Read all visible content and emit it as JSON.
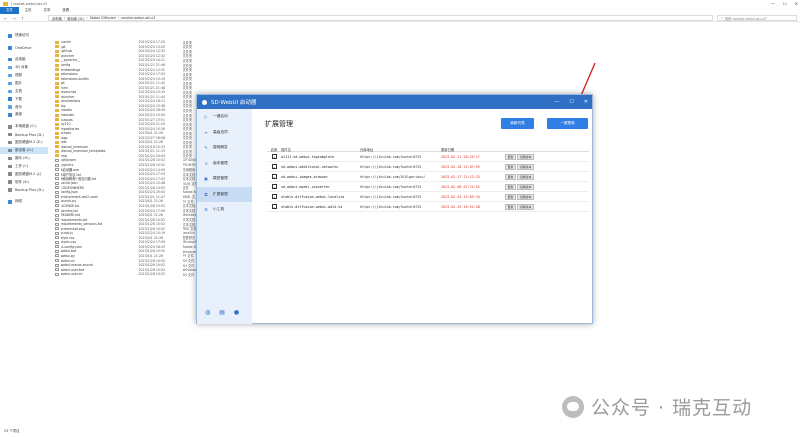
{
  "explorer": {
    "title_path": "| revelat-webui-akl-v3",
    "window_controls": [
      "—",
      "☐",
      "✕"
    ],
    "tabs": [
      "文件",
      "主页",
      "共享",
      "查看"
    ],
    "address": [
      "此电脑",
      "新加卷 (D:)",
      "Stable Diffusion",
      "novelai-webui-aki-v3"
    ],
    "search_placeholder": "搜索\"novelai-webui-aki-v3\"",
    "nav_items": [
      {
        "label": "快速访问",
        "color": "#3b87d6"
      },
      {
        "label": "OneDrive",
        "color": "#3b87d6"
      },
      {
        "label": "此电脑",
        "color": "#3b87d6"
      },
      {
        "label": "3D 对象",
        "color": "#5aa6e8"
      },
      {
        "label": "视频",
        "color": "#5aa6e8"
      },
      {
        "label": "图片",
        "color": "#5aa6e8"
      },
      {
        "label": "文档",
        "color": "#5aa6e8"
      },
      {
        "label": "下载",
        "color": "#2d7fd0"
      },
      {
        "label": "音乐",
        "color": "#5aa6e8"
      },
      {
        "label": "桌面",
        "color": "#3b87d6"
      },
      {
        "label": "本地磁盘 (C:)",
        "color": "#888888"
      },
      {
        "label": "Backup Plus (D:)",
        "color": "#888888"
      },
      {
        "label": "固态硬盘M.2 (E:)",
        "color": "#888888"
      },
      {
        "label": "新加卷 (G:)",
        "color": "#888888",
        "selected": true
      },
      {
        "label": "娱乐 (H:)",
        "color": "#888888"
      },
      {
        "label": "工作 (I:)",
        "color": "#888888"
      },
      {
        "label": "固态硬盘M.2 (J:)",
        "color": "#888888"
      },
      {
        "label": "软件 (K:)",
        "color": "#888888"
      },
      {
        "label": "Backup Plus (D:)",
        "color": "#888888"
      },
      {
        "label": "网络",
        "color": "#3b87d6"
      }
    ],
    "files": [
      {
        "name": ".cache",
        "date": "2023/2/24 17:25",
        "type": "文件夹",
        "size": "",
        "kind": "folder"
      },
      {
        "name": ".git",
        "date": "2023/2/24 13:20",
        "type": "文件夹",
        "size": "",
        "kind": "folder"
      },
      {
        "name": ".github",
        "date": "2023/2/24 12:32",
        "type": "文件夹",
        "size": "",
        "kind": "folder"
      },
      {
        "name": "launcher",
        "date": "2023/2/24 12:32",
        "type": "文件夹",
        "size": "",
        "kind": "folder"
      },
      {
        "name": "__pycache__",
        "date": "2023/2/24 14:21",
        "type": "文件夹",
        "size": "",
        "kind": "folder"
      },
      {
        "name": "config",
        "date": "2023/1/21 21:46",
        "type": "文件夹",
        "size": "",
        "kind": "folder"
      },
      {
        "name": "embeddings",
        "date": "2023/2/24 12:32",
        "type": "文件夹",
        "size": "",
        "kind": "folder"
      },
      {
        "name": "extensions",
        "date": "2023/2/24 17:03",
        "type": "文件夹",
        "size": "",
        "kind": "folder"
      },
      {
        "name": "extensions-builtin",
        "date": "2023/2/24 15:19",
        "type": "文件夹",
        "size": "",
        "kind": "folder"
      },
      {
        "name": "git",
        "date": "2023/1/21 11:42",
        "type": "文件夹",
        "size": "",
        "kind": "folder"
      },
      {
        "name": "html",
        "date": "2023/2/21 21:48",
        "type": "文件夹",
        "size": "",
        "kind": "folder"
      },
      {
        "name": "javascript",
        "date": "2023/2/24 15:19",
        "type": "文件夹",
        "size": "",
        "kind": "folder"
      },
      {
        "name": "launcher",
        "date": "2023/1/21 11:44",
        "type": "文件夹",
        "size": "",
        "kind": "folder"
      },
      {
        "name": "localizations",
        "date": "2023/2/24 18:11",
        "type": "文件夹",
        "size": "",
        "kind": "folder"
      },
      {
        "name": "log",
        "date": "2023/2/24 15:36",
        "type": "文件夹",
        "size": "",
        "kind": "folder"
      },
      {
        "name": "models",
        "date": "2023/2/24 18:49",
        "type": "文件夹",
        "size": "",
        "kind": "folder"
      },
      {
        "name": "modules",
        "date": "2023/2/24 15:20",
        "type": "文件夹",
        "size": "",
        "kind": "folder"
      },
      {
        "name": "outputs",
        "date": "2023/1/27 23:51",
        "type": "文件夹",
        "size": "",
        "kind": "folder"
      },
      {
        "name": "py310",
        "date": "2023/2/20 21:20",
        "type": "文件夹",
        "size": "",
        "kind": "folder"
      },
      {
        "name": "repositories",
        "date": "2023/2/24 15:26",
        "type": "文件夹",
        "size": "",
        "kind": "folder"
      },
      {
        "name": "scripts",
        "date": "2023/4/1 21:26",
        "type": "文件夹",
        "size": "",
        "kind": "folder"
      },
      {
        "name": "tags",
        "date": "2023/2/27 18:08",
        "type": "文件夹",
        "size": "",
        "kind": "folder"
      },
      {
        "name": "test",
        "date": "2023/4/1 21:26",
        "type": "文件夹",
        "size": "",
        "kind": "folder"
      },
      {
        "name": "textual_inversion",
        "date": "2023/2/16 15:33",
        "type": "文件夹",
        "size": "",
        "kind": "folder"
      },
      {
        "name": "textual_inversion_templates",
        "date": "2023/1/21 11:13",
        "type": "文件夹",
        "size": "",
        "kind": "folder"
      },
      {
        "name": "tmp",
        "date": "2023/2/24 20:04",
        "type": "文件夹",
        "size": "",
        "kind": "folder"
      },
      {
        "name": ".gitignore",
        "date": "2023/1/28 10:52",
        "type": "GITIGNO",
        "size": "",
        "kind": "file"
      },
      {
        "name": ".pylintrc",
        "date": "2023/1/28 10:52",
        "type": "PYLINTR",
        "size": "",
        "kind": "file"
      },
      {
        "name": "A启动器.exe",
        "date": "2023/2/24 14:09",
        "type": "应用程序",
        "size": "",
        "kind": "file"
      },
      {
        "name": "A用户协议.txt",
        "date": "2023/2/24 17:03",
        "type": "文本文档",
        "size": "",
        "kind": "file"
      },
      {
        "name": "B使用教程+常见问题.txt",
        "date": "2023/2/24 17:03",
        "type": "文本文档",
        "size": "",
        "kind": "file"
      },
      {
        "name": "cache.json",
        "date": "2023/2/24 15:48",
        "type": "JSON 文件",
        "size": "",
        "kind": "file"
      },
      {
        "name": "CODEOWNERS",
        "date": "2023/1/28 10:52",
        "type": "文件",
        "size": "",
        "kind": "file"
      },
      {
        "name": "config.json",
        "date": "2023/2/24 20:04",
        "type": "Adobe Af",
        "size": "",
        "kind": "file"
      },
      {
        "name": "environment-wsl2.yaml",
        "date": "2023/1/21 11:47",
        "type": "YAML 文",
        "size": "",
        "kind": "file"
      },
      {
        "name": "launch.py",
        "date": "2023/4/1 21:26",
        "type": "PY 文件",
        "size": "",
        "kind": "file"
      },
      {
        "name": "LICENSE.txt",
        "date": "2023/1/28 10:52",
        "type": "文本文档",
        "size": "",
        "kind": "file"
      },
      {
        "name": "params.txt",
        "date": "2023/2/24 17:09",
        "type": "文本文档",
        "size": "",
        "kind": "file"
      },
      {
        "name": "README.md",
        "date": "2023/4/1 21:26",
        "type": "Markdow",
        "size": "",
        "kind": "file"
      },
      {
        "name": "requirements.txt",
        "date": "2023/1/28 10:52",
        "type": "文本文档",
        "size": "",
        "kind": "file"
      },
      {
        "name": "requirements_versions.txt",
        "date": "2023/1/28 10:52",
        "type": "文本文档",
        "size": "",
        "kind": "file"
      },
      {
        "name": "screenshot.png",
        "date": "2023/1/28 10:52",
        "type": "PNG 文件",
        "size": "",
        "kind": "file"
      },
      {
        "name": "script.js",
        "date": "2023/2/24 15:19",
        "type": "JavaScri",
        "size": "",
        "kind": "file"
      },
      {
        "name": "style.css",
        "date": "2023/4/1 21:26",
        "type": "层叠样式",
        "size": "",
        "kind": "file"
      },
      {
        "name": "styles.csv",
        "date": "2023/2/24 17:09",
        "type": "Microsoft Excel",
        "size": "1 KB",
        "kind": "file"
      },
      {
        "name": "ui-config.json",
        "date": "2023/2/24 18:43",
        "type": "Adobe After Effe",
        "size": "53 KB",
        "kind": "file"
      },
      {
        "name": "webui.bat",
        "date": "2023/1/28 10:52",
        "type": "Windows 批处理...",
        "size": "3 KB",
        "kind": "file"
      },
      {
        "name": "webui.py",
        "date": "2023/4/1 21:26",
        "type": "PY 文件",
        "size": "11 KB",
        "kind": "file"
      },
      {
        "name": "webui.sh",
        "date": "2023/1/28 10:52",
        "type": "SH 文件",
        "size": "6 KB",
        "kind": "file"
      },
      {
        "name": "webui-macos-env.sh",
        "date": "2023/1/28 10:52",
        "type": "SH 文件",
        "size": "1 KB",
        "kind": "file"
      },
      {
        "name": "webui-user.bat",
        "date": "2023/1/28 10:52",
        "type": "Windows 批处理...",
        "size": "1 KB",
        "kind": "file"
      },
      {
        "name": "webui-user.sh",
        "date": "2023/1/28 10:52",
        "type": "SH 文件",
        "size": "2 KB",
        "kind": "file"
      }
    ],
    "status": "53 个项目"
  },
  "launcher": {
    "title": "SD-WebUI 启动器",
    "window_controls": [
      "—",
      "☐",
      "✕"
    ],
    "nav": [
      {
        "label": "一键启动",
        "symbol": "▷"
      },
      {
        "label": "高级选项",
        "symbol": "≡"
      },
      {
        "label": "疑难解答",
        "symbol": "✎"
      },
      {
        "label": "版本管理",
        "symbol": "⊙"
      },
      {
        "label": "模型管理",
        "symbol": "▣"
      },
      {
        "label": "扩展管理",
        "symbol": "⧉",
        "active": true
      },
      {
        "label": "小工具",
        "symbol": "⚙"
      }
    ],
    "footer_icons": [
      "◍",
      "▤",
      "●"
    ],
    "page_title": "扩展管理",
    "btn_refresh": "刷新列表",
    "btn_update": "一键更新",
    "columns": [
      "启用",
      "插件名",
      "仓库地址",
      "更新日期"
    ],
    "rows": [
      {
        "enabled": true,
        "name": "a1111-sd-webui-tagcomplete",
        "url": "https://jihulab.com/hunter0725",
        "date": "2023-02-21 20:25:17",
        "actions": [
          "更新",
          "切换版本"
        ]
      },
      {
        "enabled": true,
        "name": "sd-webui-additional-networks",
        "url": "https://jihulab.com/hunter0725",
        "date": "2023-02-18 21:07:59",
        "actions": [
          "更新",
          "切换版本"
        ]
      },
      {
        "enabled": true,
        "name": "sd-webui-images-browser",
        "url": "https://jihulab.com/AlUlgarious/",
        "date": "2023-02-27 21:12:23",
        "actions": [
          "更新",
          "切换版本"
        ]
      },
      {
        "enabled": true,
        "name": "sd-webui-model-converter",
        "url": "https://jihulab.com/hunter0725",
        "date": "2023-02-08 07:21:52",
        "actions": [
          "更新",
          "切换版本"
        ]
      },
      {
        "enabled": true,
        "name": "stable-diffusion-webui-localiza",
        "url": "https://jihulab.com/hunter0725",
        "date": "2023-02-24 13:09:34",
        "actions": [
          "更新",
          "切换版本"
        ]
      },
      {
        "enabled": true,
        "name": "stable-diffusion-webui-wd14-ta",
        "url": "https://jihulab.com/hunter0725",
        "date": "2023-02-19 16:51:48",
        "actions": [
          "更新",
          "切换版本"
        ]
      }
    ]
  },
  "watermark": "公众号 · 瑞克互动"
}
